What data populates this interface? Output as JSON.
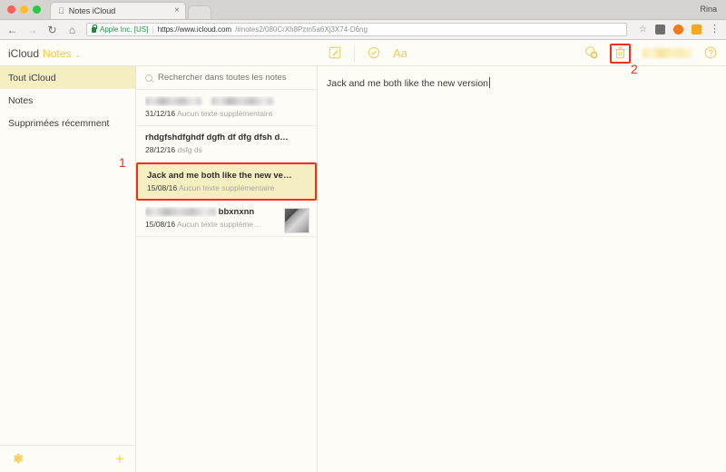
{
  "browser": {
    "tab": {
      "title": "Notes iCloud",
      "favicon": "apple-icon",
      "close": "×"
    },
    "profile": "Rina",
    "nav": {
      "back": "←",
      "forward": "→",
      "reload": "↻",
      "home": "⌂"
    },
    "omnibox": {
      "security_label": "Apple Inc. [US]",
      "separator": "|",
      "url_strong": "https://www.icloud.com",
      "url_rest": "/#notes2/080CrXh8Pzm5a6Xj3X74-D6ng",
      "bookmark": "☆"
    },
    "menu": "⋮"
  },
  "app": {
    "brand": {
      "icloud": "iCloud",
      "name": "Notes",
      "caret": "⌄"
    },
    "toolbar": {
      "compose": "✎",
      "checklist": "✓",
      "format": "Aa"
    },
    "right_toolbar": {
      "add_people": "ⓘ",
      "delete": "🗑",
      "account_name": "",
      "help": "?"
    }
  },
  "sidebar": {
    "items": [
      {
        "label": "Tout iCloud",
        "active": true
      },
      {
        "label": "Notes",
        "active": false
      },
      {
        "label": "Supprimées récemment",
        "active": false
      }
    ],
    "footer": {
      "settings": "⚙",
      "add": "+"
    }
  },
  "list": {
    "search_placeholder": "Rechercher dans toutes les notes",
    "search_value": "",
    "notes": [
      {
        "title": "",
        "title_blurred": true,
        "date": "31/12/16",
        "extra": "Aucun texte supplémentaire",
        "selected": false,
        "thumbnail": false
      },
      {
        "title": "rhdgfshdfghdf dgfh df dfg dfsh d…",
        "title_blurred": false,
        "date": "28/12/16",
        "extra": "dsfg ds",
        "selected": false,
        "thumbnail": false
      },
      {
        "title": "Jack and me both like the new ve…",
        "title_blurred": false,
        "date": "15/08/16",
        "extra": "Aucun texte supplémentaire",
        "selected": true,
        "thumbnail": false
      },
      {
        "title": "bbxnxnn",
        "title_blurred": true,
        "date": "15/08/16",
        "extra": "Aucun texte suppléme…",
        "selected": false,
        "thumbnail": true
      }
    ]
  },
  "editor": {
    "content": "Jack and me both like the new version"
  },
  "annotations": [
    {
      "id": "1",
      "label": "1"
    },
    {
      "id": "2",
      "label": "2"
    }
  ],
  "colors": {
    "accent_yellow": "#f2c94c",
    "selection_bg": "#f5eec0",
    "annotation_red": "#f22f1d",
    "app_bg": "#fdfcf7"
  }
}
